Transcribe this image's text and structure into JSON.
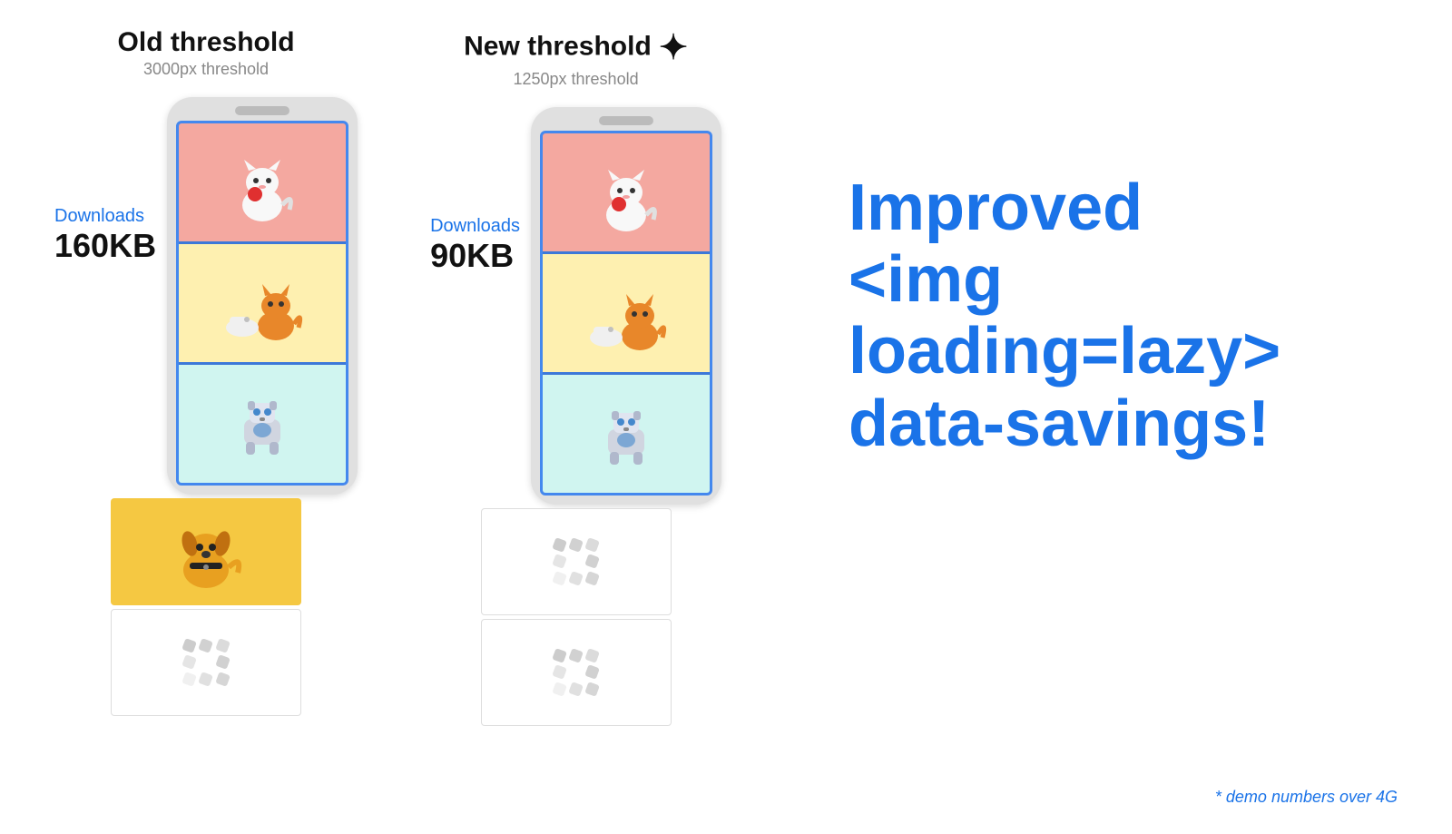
{
  "columns": {
    "old": {
      "title": "Old threshold",
      "subtitle": "3000px threshold",
      "downloads_label": "Downloads",
      "downloads_size": "160KB"
    },
    "new": {
      "title": "New threshold",
      "subtitle": "1250px threshold",
      "downloads_label": "Downloads",
      "downloads_size": "90KB",
      "sparkle": "✦"
    }
  },
  "right": {
    "line1": "Improved",
    "line2": "<img loading=lazy>",
    "line3": "data-savings!"
  },
  "demo_note": "* demo numbers over 4G"
}
